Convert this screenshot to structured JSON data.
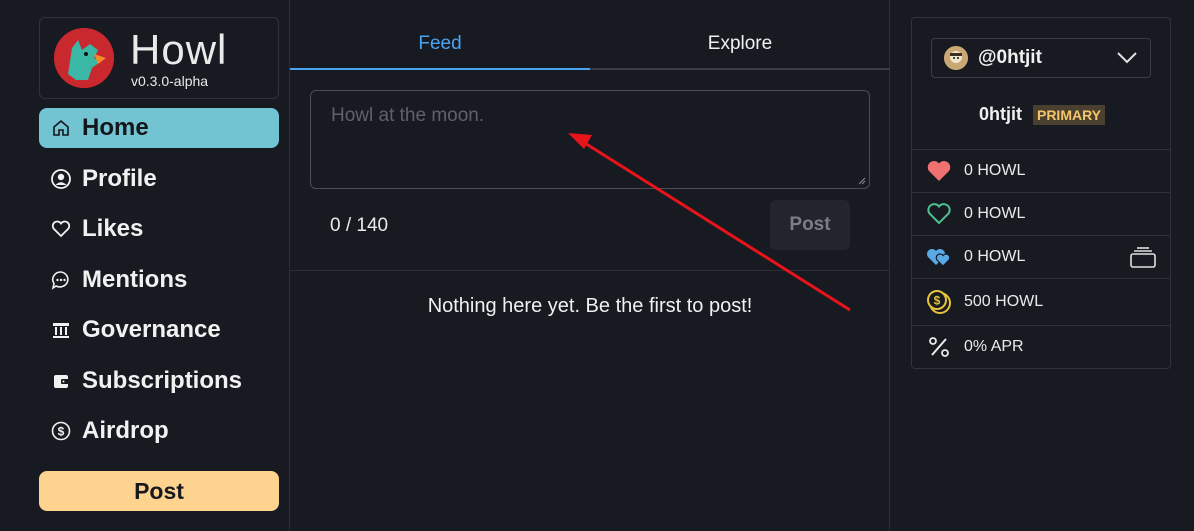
{
  "brand": {
    "name": "Howl",
    "version": "v0.3.0-alpha"
  },
  "nav": {
    "items": [
      {
        "label": "Home",
        "icon": "home-icon",
        "active": true
      },
      {
        "label": "Profile",
        "icon": "user-circle-icon"
      },
      {
        "label": "Likes",
        "icon": "heart-icon"
      },
      {
        "label": "Mentions",
        "icon": "chat-bubble-icon"
      },
      {
        "label": "Governance",
        "icon": "bank-icon"
      },
      {
        "label": "Subscriptions",
        "icon": "wallet-icon"
      },
      {
        "label": "Airdrop",
        "icon": "coin-icon"
      }
    ],
    "post_label": "Post"
  },
  "main": {
    "tabs": [
      {
        "label": "Feed",
        "active": true
      },
      {
        "label": "Explore"
      }
    ],
    "composer": {
      "placeholder": "Howl at the moon.",
      "value": ""
    },
    "counter": "0 / 140",
    "post_label": "Post",
    "empty_message": "Nothing here yet. Be the first to post!"
  },
  "account": {
    "handle": "@0htjit",
    "name": "0htjit",
    "badge": "PRIMARY",
    "stats": [
      {
        "icon": "heart-filled-icon",
        "text": "0 HOWL",
        "color": "#f07171"
      },
      {
        "icon": "heart-outline-icon",
        "text": "0 HOWL",
        "color": "#4fc08d"
      },
      {
        "icon": "hearts-icon",
        "text": "0 HOWL",
        "color": "#5aa9e6"
      },
      {
        "icon": "coins-icon",
        "text": "500 HOWL",
        "color": "#e6c33a"
      },
      {
        "icon": "percent-icon",
        "text": "0% APR",
        "color": "#eaeaea"
      }
    ]
  },
  "colors": {
    "accent": "#4aa3f0",
    "active_nav": "#72c4d2",
    "post_button": "#fdd38f",
    "annotation_arrow": "#e8141a"
  }
}
